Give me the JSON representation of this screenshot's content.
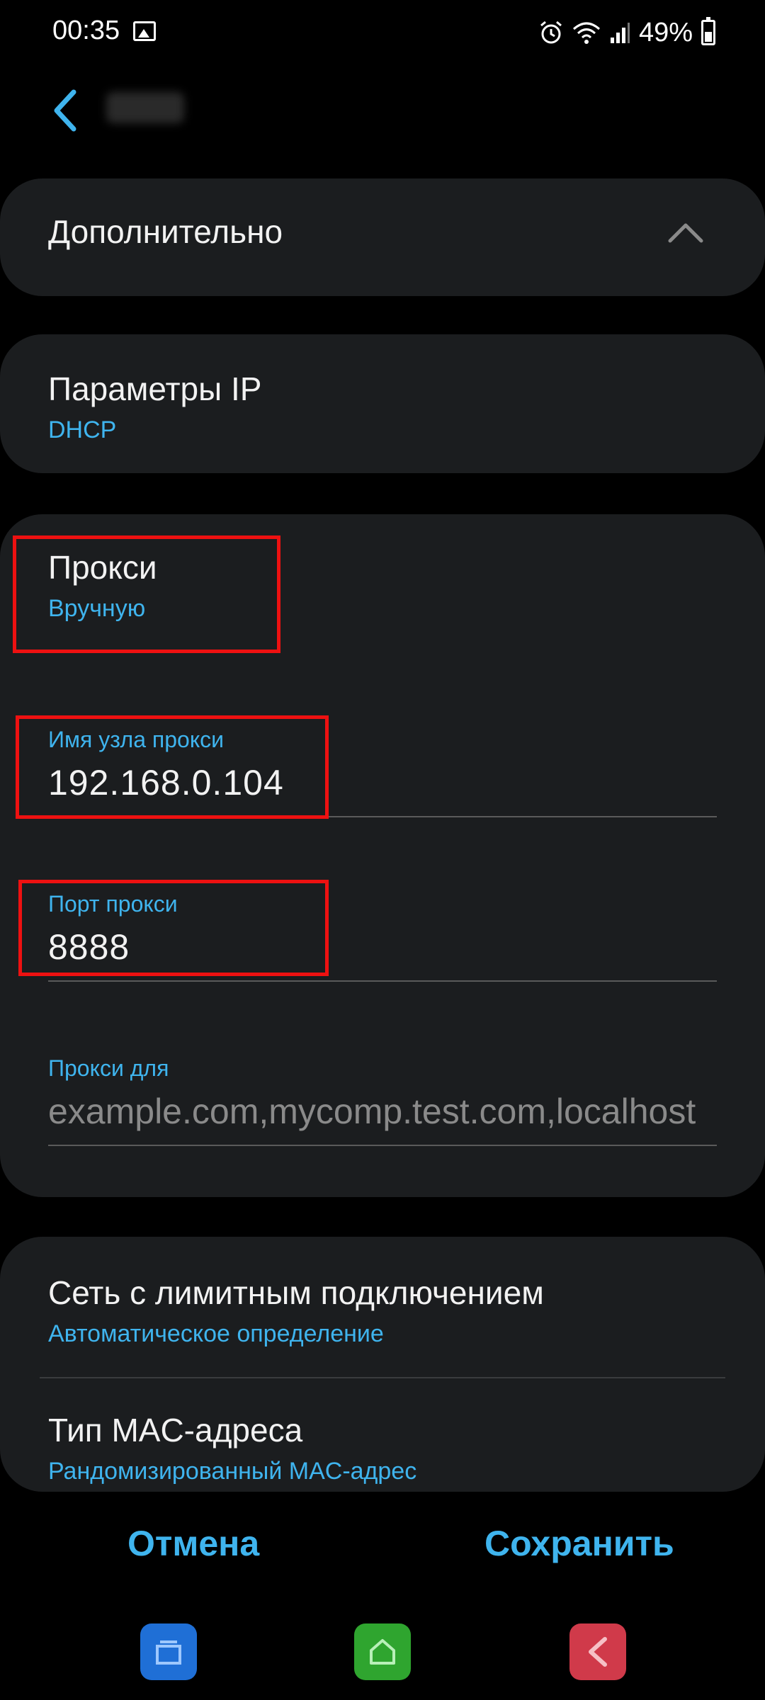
{
  "status_bar": {
    "time": "00:35",
    "battery": "49%",
    "icons": [
      "image-icon",
      "alarm-icon",
      "wifi-icon",
      "signal-icon",
      "battery-icon"
    ]
  },
  "header": {
    "back_icon": "chevron-left-icon"
  },
  "advanced": {
    "title": "Дополнительно",
    "icon": "chevron-up-icon"
  },
  "ip_settings": {
    "title": "Параметры IP",
    "value": "DHCP"
  },
  "proxy": {
    "title": "Прокси",
    "value": "Вручную",
    "hostname_label": "Имя узла прокси",
    "hostname_value": "192.168.0.104",
    "port_label": "Порт прокси",
    "port_value": "8888",
    "bypass_label": "Прокси для",
    "bypass_placeholder": "example.com,mycomp.test.com,localhost"
  },
  "metered": {
    "title": "Сеть с лимитным подключением",
    "value": "Автоматическое определение"
  },
  "mac": {
    "title": "Тип MAC-адреса",
    "value": "Рандомизированный MAC-адрес"
  },
  "actions": {
    "cancel": "Отмена",
    "save": "Сохранить"
  },
  "colors": {
    "accent": "#3fb4ee",
    "card": "#1b1d1f",
    "highlight": "#ee1111",
    "nav_recent": "#1f6fd6",
    "nav_home": "#2fa52f",
    "nav_back": "#d03a4a"
  }
}
